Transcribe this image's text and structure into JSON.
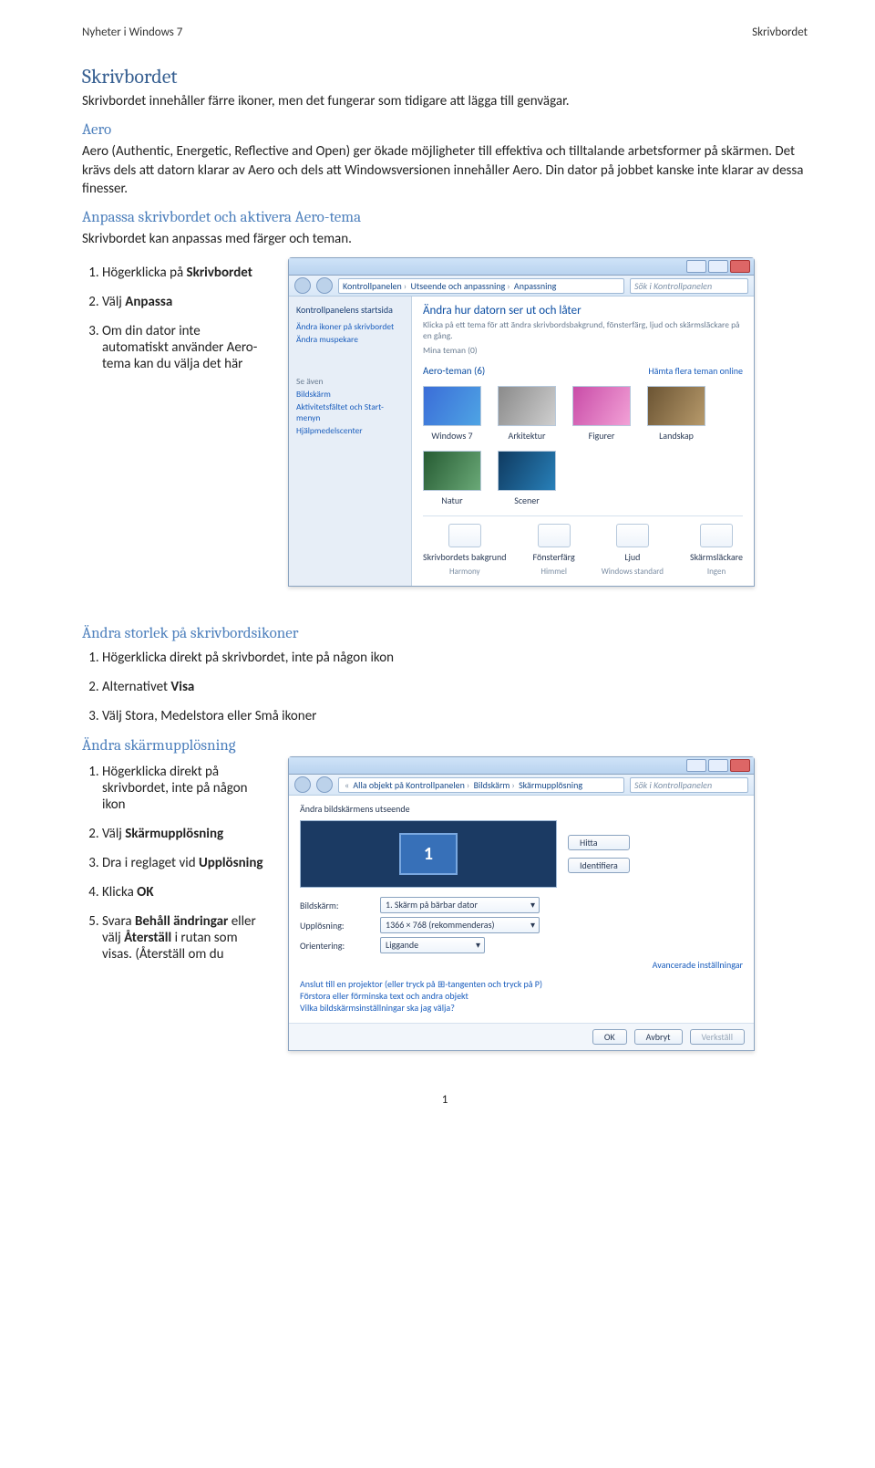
{
  "header": {
    "left": "Nyheter i Windows 7",
    "right": "Skrivbordet"
  },
  "h_skrivbordet": "Skrivbordet",
  "p_skrivbordet": "Skrivbordet innehåller färre ikoner, men det fungerar som tidigare att lägga till genvägar.",
  "h_aero": "Aero",
  "p_aero": "Aero (Authentic, Energetic, Reflective and Open) ger ökade möjligheter till effektiva och tilltalande arbetsformer på skärmen. Det krävs dels att datorn klarar av Aero och dels att Windowsversionen innehåller Aero. Din dator på jobbet kanske inte klarar av dessa finesser.",
  "h_anpassa": "Anpassa skrivbordet och aktivera Aero-tema",
  "p_anpassa": "Skrivbordet kan anpassas med färger och teman.",
  "steps_anpassa": {
    "s1a": "Högerklicka på ",
    "s1b": "Skrivbordet",
    "s2a": "Välj ",
    "s2b": "Anpassa",
    "s3": "Om din dator inte automatiskt använder Aero-tema kan du välja det här"
  },
  "h_ikoner": "Ändra storlek på skrivbordsikoner",
  "steps_ikoner": {
    "s1": "Högerklicka direkt på skrivbordet, inte på någon ikon",
    "s2a": "Alternativet ",
    "s2b": "Visa",
    "s3": "Välj Stora, Medelstora eller Små ikoner"
  },
  "h_upplos": "Ändra skärmupplösning",
  "steps_upplos": {
    "s1": "Högerklicka direkt på skrivbordet, inte på någon ikon",
    "s2a": "Välj ",
    "s2b": "Skärmupplösning",
    "s3a": "Dra i reglaget vid ",
    "s3b": "Upplösning",
    "s4a": "Klicka ",
    "s4b": "OK",
    "s5a": "Svara ",
    "s5b": "Behåll ändringar",
    "s5c": " eller välj ",
    "s5d": "Återställ",
    "s5e": " i rutan som visas. (Återställ om du"
  },
  "page_number": "1",
  "shot1": {
    "crumbs": [
      "Kontrollpanelen",
      "Utseende och anpassning",
      "Anpassning"
    ],
    "search_placeholder": "Sök i Kontrollpanelen",
    "side_head": "Kontrollpanelens startsida",
    "side_links": [
      "Ändra ikoner på skrivbordet",
      "Ändra muspekare"
    ],
    "side2_head": "Se även",
    "side2_links": [
      "Bildskärm",
      "Aktivitetsfältet och Start-menyn",
      "Hjälpmedelscenter"
    ],
    "main_head": "Ändra hur datorn ser ut och låter",
    "main_info": "Klicka på ett tema för att ändra skrivbordsbakgrund, fönsterfärg, ljud och skärmsläckare på en gång.",
    "my_themes_label": "Mina teman (0)",
    "aero_themes_label": "Aero-teman (6)",
    "more_themes": "Hämta flera teman online",
    "themes_row1": [
      "Windows 7",
      "Arkitektur",
      "Figurer",
      "Landskap"
    ],
    "themes_row2": [
      "Natur",
      "Scener"
    ],
    "bottom": [
      {
        "label": "Skrivbordets bakgrund",
        "value": "Harmony"
      },
      {
        "label": "Fönsterfärg",
        "value": "Himmel"
      },
      {
        "label": "Ljud",
        "value": "Windows standard"
      },
      {
        "label": "Skärmsläckare",
        "value": "Ingen"
      }
    ]
  },
  "shot2": {
    "crumbs": [
      "Alla objekt på Kontrollpanelen",
      "Bildskärm",
      "Skärmupplösning"
    ],
    "search_placeholder": "Sök i Kontrollpanelen",
    "head": "Ändra bildskärmens utseende",
    "btn_find": "Hitta",
    "btn_ident": "Identifiera",
    "mon_number": "1",
    "rows": {
      "display_label": "Bildskärm:",
      "display_value": "1. Skärm på bärbar dator",
      "res_label": "Upplösning:",
      "res_value": "1366 × 768 (rekommenderas)",
      "orient_label": "Orientering:",
      "orient_value": "Liggande"
    },
    "adv_link": "Avancerade inställningar",
    "blinks": [
      "Anslut till en projektor (eller tryck på ⊞-tangenten och tryck på P)",
      "Förstora eller förminska text och andra objekt",
      "Vilka bildskärmsinställningar ska jag välja?"
    ],
    "btn_ok": "OK",
    "btn_cancel": "Avbryt",
    "btn_apply": "Verkställ"
  }
}
